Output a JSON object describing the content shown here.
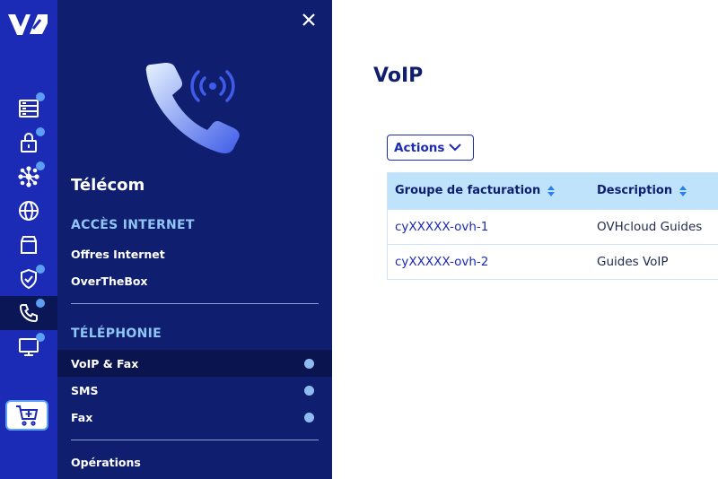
{
  "rail": {
    "items": [
      {
        "icon": "server-icon"
      },
      {
        "icon": "lock-icon"
      },
      {
        "icon": "network-icon"
      },
      {
        "icon": "globe-icon"
      },
      {
        "icon": "package-icon"
      },
      {
        "icon": "shield-check-icon"
      },
      {
        "icon": "phone-icon"
      },
      {
        "icon": "monitor-icon"
      }
    ],
    "cart_icon": "cart-plus-icon"
  },
  "menu": {
    "title": "Télécom",
    "sections": [
      {
        "title": "ACCÈS INTERNET",
        "links": [
          "Offres Internet",
          "OverTheBox"
        ]
      },
      {
        "title": "TÉLÉPHONIE",
        "links": [
          "VoIP & Fax",
          "SMS",
          "Fax"
        ]
      }
    ],
    "footer_link": "Opérations"
  },
  "main": {
    "title": "VoIP",
    "actions_label": "Actions",
    "table": {
      "columns": [
        "Groupe de facturation",
        "Description"
      ],
      "rows": [
        [
          "cyXXXXX-ovh-1",
          "OVHcloud Guides"
        ],
        [
          "cyXXXXX-ovh-2",
          "Guides VoIP"
        ]
      ]
    }
  },
  "colors": {
    "rail_bg": "#1b2bb5",
    "menu_bg": "#0f1e6e",
    "accent": "#5c9ff2",
    "table_header_bg": "#bfe3fb"
  }
}
